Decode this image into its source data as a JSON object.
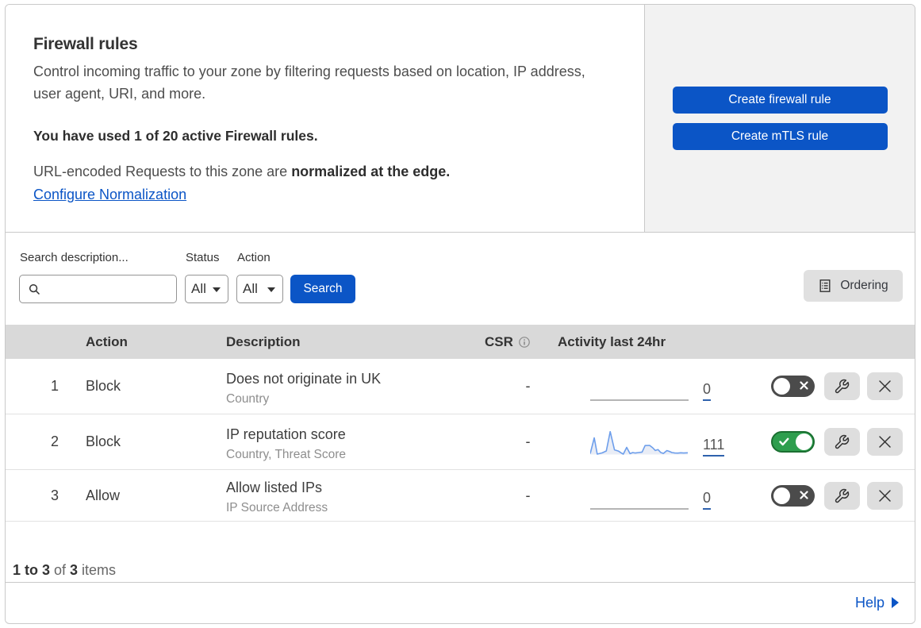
{
  "colors": {
    "accent_blue": "#0b55c6",
    "toggle_on_green": "#2e9e4e",
    "toggle_off_gray": "#4b4b4b",
    "panel_gray": "#f2f2f2",
    "table_header_gray": "#d9d9d9",
    "sparkline_blue": "#6d9eeb"
  },
  "header": {
    "title": "Firewall rules",
    "description": "Control incoming traffic to your zone by filtering requests based on location, IP address, user agent, URI, and more.",
    "usage": "You have used 1 of 20 active Firewall rules.",
    "normalization_text": "URL-encoded Requests to this zone are ",
    "normalization_bold": "normalized at the edge.",
    "normalization_link": "Configure Normalization",
    "create_firewall_rule_label": "Create firewall rule",
    "create_mtls_rule_label": "Create mTLS rule"
  },
  "filters": {
    "search_label": "Search description...",
    "search_value": "",
    "status_label": "Status",
    "status_value": "All",
    "action_label": "Action",
    "action_value": "All",
    "search_button_label": "Search",
    "ordering_button_label": "Ordering"
  },
  "table": {
    "columns": {
      "action": "Action",
      "description": "Description",
      "csr": "CSR",
      "activity": "Activity last 24hr"
    },
    "rows": [
      {
        "num": "1",
        "action": "Block",
        "description": "Does not originate in UK",
        "criteria": "Country",
        "csr": "-",
        "activity_count": "0",
        "enabled": false,
        "sparkline": null
      },
      {
        "num": "2",
        "action": "Block",
        "description": "IP reputation score",
        "criteria": "Country, Threat Score",
        "csr": "-",
        "activity_count": "111",
        "enabled": true,
        "sparkline": {
          "width": 124,
          "height": 32,
          "points": [
            [
              0,
              28.4
            ],
            [
              5.1,
              8.5
            ],
            [
              8.9,
              29
            ],
            [
              15.2,
              27.4
            ],
            [
              20.3,
              25
            ],
            [
              25.2,
              0.6
            ],
            [
              30.6,
              23.6
            ],
            [
              35.5,
              25.1
            ],
            [
              39,
              27.4
            ],
            [
              41.7,
              29
            ],
            [
              46,
              20.5
            ],
            [
              50.2,
              28.4
            ],
            [
              53.6,
              27
            ],
            [
              56.9,
              27.6
            ],
            [
              61,
              27
            ],
            [
              65.4,
              26.4
            ],
            [
              69.2,
              18.2
            ],
            [
              74.9,
              18
            ],
            [
              78.8,
              21
            ],
            [
              82.1,
              24.4
            ],
            [
              85.5,
              23.3
            ],
            [
              89,
              27
            ],
            [
              92.3,
              28.1
            ],
            [
              96.7,
              24.5
            ],
            [
              100,
              25.6
            ],
            [
              103,
              27
            ],
            [
              106.7,
              27.6
            ],
            [
              110.5,
              27.7
            ],
            [
              114.2,
              27.3
            ],
            [
              117.8,
              27.6
            ],
            [
              123,
              27.3
            ]
          ]
        }
      },
      {
        "num": "3",
        "action": "Allow",
        "description": "Allow listed IPs",
        "criteria": "IP Source Address",
        "csr": "-",
        "activity_count": "0",
        "enabled": false,
        "sparkline": null
      }
    ]
  },
  "footer": {
    "range": "1 to 3",
    "of_text": " of ",
    "total": "3",
    "items_text": " items"
  },
  "help": {
    "label": "Help"
  }
}
